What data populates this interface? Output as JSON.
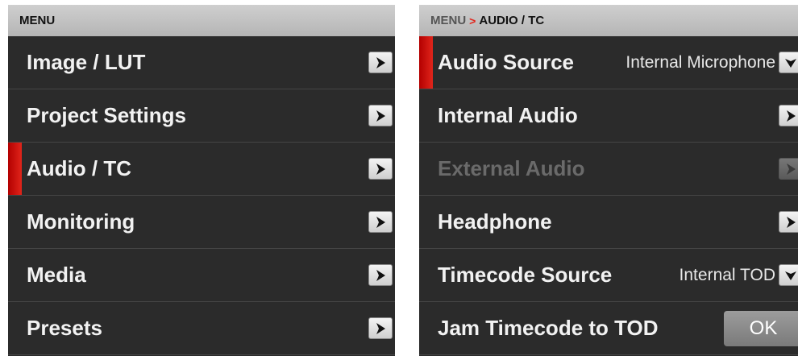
{
  "left_panel": {
    "header": "MENU",
    "items": [
      {
        "label": "Image / LUT",
        "icon": "chevron-right-icon"
      },
      {
        "label": "Project Settings",
        "icon": "chevron-right-icon"
      },
      {
        "label": "Audio / TC",
        "icon": "chevron-right-icon",
        "selected": true
      },
      {
        "label": "Monitoring",
        "icon": "chevron-right-icon"
      },
      {
        "label": "Media",
        "icon": "chevron-right-icon"
      },
      {
        "label": "Presets",
        "icon": "chevron-right-icon"
      }
    ]
  },
  "right_panel": {
    "breadcrumb": {
      "parent": "MENU",
      "separator": ">",
      "current": "AUDIO / TC"
    },
    "items": [
      {
        "label": "Audio Source",
        "value": "Internal Microphone",
        "icon": "chevron-down-icon",
        "selected": true
      },
      {
        "label": "Internal Audio",
        "icon": "chevron-right-icon"
      },
      {
        "label": "External Audio",
        "icon": "chevron-right-icon",
        "disabled": true
      },
      {
        "label": "Headphone",
        "icon": "chevron-right-icon"
      },
      {
        "label": "Timecode Source",
        "value": "Internal TOD",
        "icon": "chevron-down-icon"
      },
      {
        "label": "Jam Timecode to TOD",
        "button": "OK"
      }
    ]
  },
  "colors": {
    "background": "#2b2b2b",
    "accent": "#e2231a",
    "header": "#c4c4c4",
    "text": "#f2f2f2",
    "disabled_text": "#6a6a6a"
  }
}
